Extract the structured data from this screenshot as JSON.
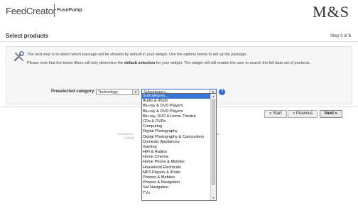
{
  "header": {
    "brand": "FeedCreator",
    "sub_brand": "FusePump",
    "client_logo": "M&S"
  },
  "page": {
    "title": "Select products",
    "step_prefix": "Step 3 of",
    "step_total": "5"
  },
  "panel": {
    "icon": "tools-icon",
    "info_line1": "The next step is to select which package will be showed by default in your widget. Use the options below to set up the package.",
    "info_line2_pre": "Please note that the below filters will only determine the",
    "info_line2_bold": "default selection",
    "info_line2_post": "for your widget. The widget will still enable the user to search the full data set of products."
  },
  "filters": {
    "category_label": "Preselected category:",
    "category_value": "Technology",
    "subcategory_value": "Subcategory..."
  },
  "subcategory_options": [
    "Subcategory...",
    "Audio & iPods",
    "Blu-ray & DVD Players",
    "Blu-ray & DVD Players",
    "Blu-ray, DVD & Home Theatre",
    "CDs & DVDs",
    "Computing",
    "Digital Photography",
    "Digital Photography & Camcorders",
    "Domestic Appliances",
    "Gaming",
    "HiFi & Radios",
    "Home Cinema",
    "Home Phone & Mobiles",
    "Household Electricals",
    "MP3 Players & iPods",
    "Phones & Mobiles",
    "Phones & Navigation",
    "Sat Navigation",
    "TVs"
  ],
  "buttons": {
    "start": "« Start",
    "previous": "« Previous",
    "next": "Next »"
  },
  "footer": {
    "line1": "Technical su",
    "line1_end": "02026",
    "line2": "Copyrig"
  },
  "colors": {
    "selection": "#3875d7",
    "help": "#3366cc"
  }
}
